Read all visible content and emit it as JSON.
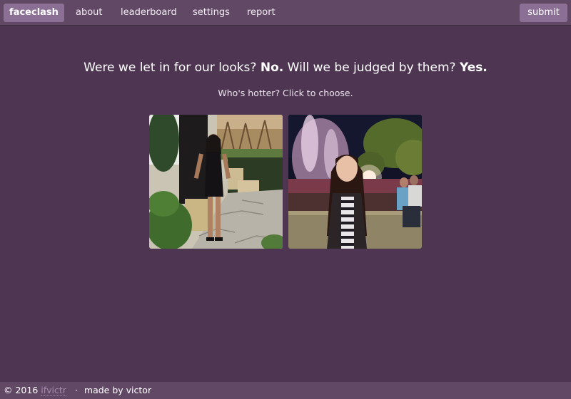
{
  "nav": {
    "brand": "faceclash",
    "links": [
      "about",
      "leaderboard",
      "settings",
      "report"
    ],
    "submit": "submit"
  },
  "main": {
    "headline": {
      "part1": "Were we let in for our looks?",
      "answer1": "No.",
      "part2": "Will we be judged by them?",
      "answer2": "Yes."
    },
    "instruction": "Who's hotter? Click to choose."
  },
  "footer": {
    "copyright": "© 2016",
    "author_link": "ifvictr",
    "separator": "·",
    "made_by": "made by victor"
  },
  "colors": {
    "background": "#4e3652",
    "navbar": "#614965",
    "button": "#8c6f95",
    "footer_link": "#a68aae"
  }
}
